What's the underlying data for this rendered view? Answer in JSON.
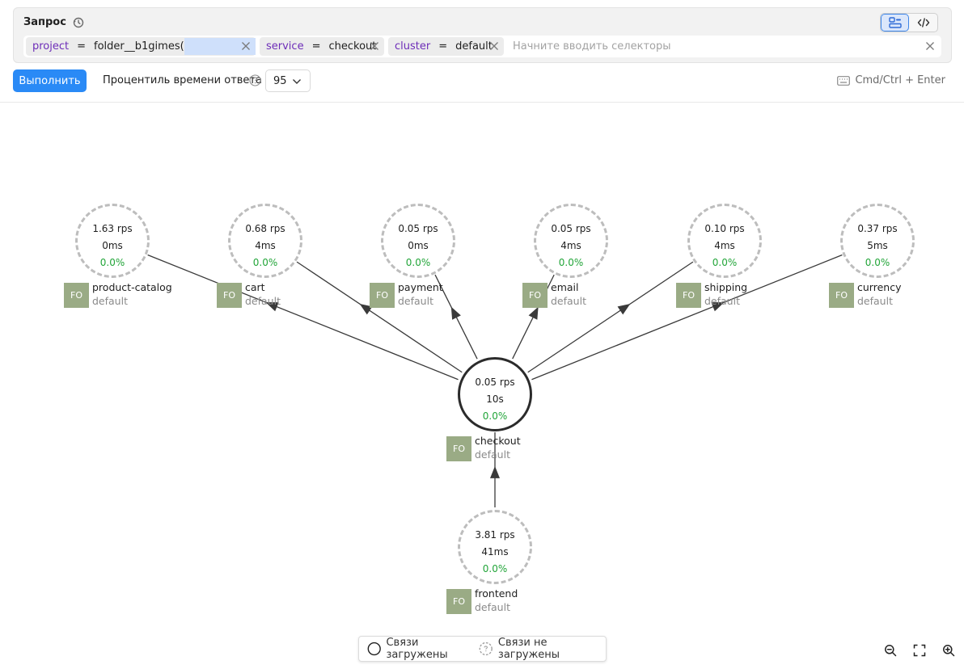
{
  "query": {
    "title": "Запрос",
    "chips": [
      {
        "key": "project",
        "op": "=",
        "value": "folder__b1gimes("
      },
      {
        "key": "service",
        "op": "=",
        "value": "checkout"
      },
      {
        "key": "cluster",
        "op": "=",
        "value": "default"
      }
    ],
    "placeholder": "Начните вводить селекторы"
  },
  "toolbar": {
    "run_label": "Выполнить",
    "percentile_label": "Процентиль времени ответа",
    "percentile_value": "95",
    "shortcut": "Cmd/Ctrl + Enter"
  },
  "nodes": [
    {
      "id": "product-catalog",
      "rps": "1.63 rps",
      "latency": "0ms",
      "errors": "0.0%",
      "badge": "FO",
      "name": "product-catalog",
      "namespace": "default",
      "loaded": false
    },
    {
      "id": "cart",
      "rps": "0.68 rps",
      "latency": "4ms",
      "errors": "0.0%",
      "badge": "FO",
      "name": "cart",
      "namespace": "default",
      "loaded": false
    },
    {
      "id": "payment",
      "rps": "0.05 rps",
      "latency": "0ms",
      "errors": "0.0%",
      "badge": "FO",
      "name": "payment",
      "namespace": "default",
      "loaded": false
    },
    {
      "id": "email",
      "rps": "0.05 rps",
      "latency": "4ms",
      "errors": "0.0%",
      "badge": "FO",
      "name": "email",
      "namespace": "default",
      "loaded": false
    },
    {
      "id": "shipping",
      "rps": "0.10 rps",
      "latency": "4ms",
      "errors": "0.0%",
      "badge": "FO",
      "name": "shipping",
      "namespace": "default",
      "loaded": false
    },
    {
      "id": "currency",
      "rps": "0.37 rps",
      "latency": "5ms",
      "errors": "0.0%",
      "badge": "FO",
      "name": "currency",
      "namespace": "default",
      "loaded": false
    },
    {
      "id": "checkout",
      "rps": "0.05 rps",
      "latency": "10s",
      "errors": "0.0%",
      "badge": "FO",
      "name": "checkout",
      "namespace": "default",
      "loaded": true
    },
    {
      "id": "frontend",
      "rps": "3.81 rps",
      "latency": "41ms",
      "errors": "0.0%",
      "badge": "FO",
      "name": "frontend",
      "namespace": "default",
      "loaded": false
    }
  ],
  "edges": [
    {
      "from": "checkout",
      "to": "product-catalog"
    },
    {
      "from": "checkout",
      "to": "cart"
    },
    {
      "from": "checkout",
      "to": "payment"
    },
    {
      "from": "checkout",
      "to": "email"
    },
    {
      "from": "checkout",
      "to": "shipping"
    },
    {
      "from": "checkout",
      "to": "currency"
    },
    {
      "from": "frontend",
      "to": "checkout"
    }
  ],
  "legend": {
    "loaded": "Связи загружены",
    "not_loaded": "Связи не загружены"
  },
  "colors": {
    "accent": "#2a8af6",
    "key": "#6d2db8",
    "error_ok": "#22a539",
    "badge": "#9aab85"
  }
}
